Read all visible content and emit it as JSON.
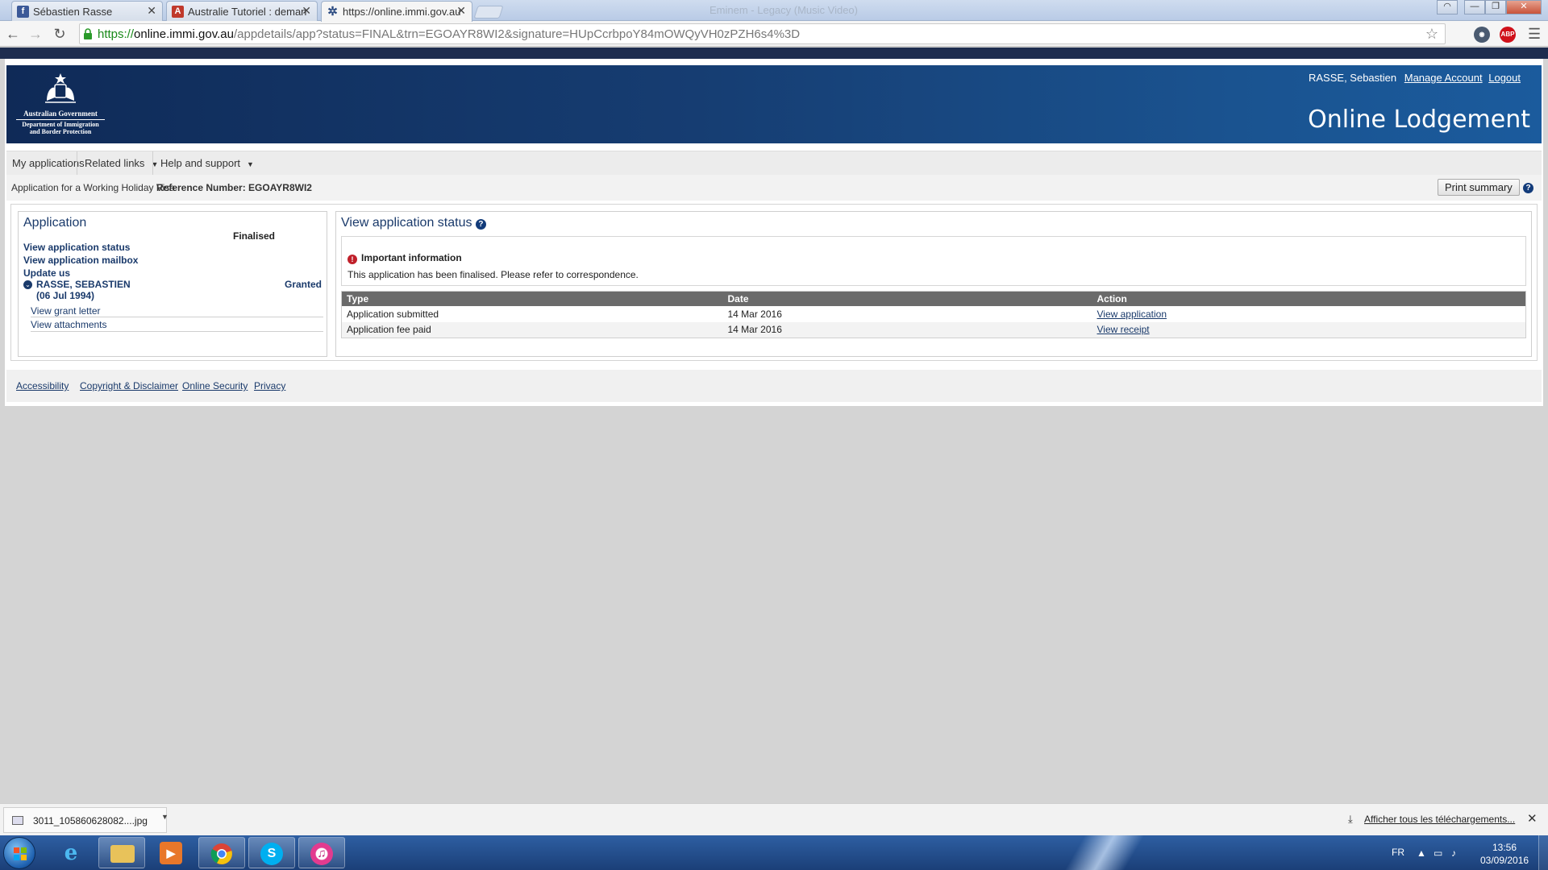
{
  "browser": {
    "tabs": [
      {
        "title": "Sébastien Rasse",
        "icon": "facebook-icon"
      },
      {
        "title": "Australie Tutoriel : deman",
        "icon": "pdf-icon"
      },
      {
        "title": "https://online.immi.gov.au",
        "icon": "loading-gear-icon"
      }
    ],
    "ghost_title": "Eminem - Legacy (Music Video)",
    "url_proto": "https://",
    "url_host": "online.immi.gov.au",
    "url_path": "/appdetails/app?status=FINAL&trn=EGOAYR8WI2&signature=HUpCcrbpoY84mOWQyVH0zPZH6s4%3D",
    "extensions": [
      "eye-extension-icon",
      "adblock-plus-icon"
    ],
    "adblock_label": "ABP"
  },
  "header": {
    "crest_line1": "Australian Government",
    "crest_line2": "Department of Immigration and Border Protection",
    "user_name": "RASSE, Sebastien",
    "manage_account": "Manage Account",
    "logout": "Logout",
    "site_title": "Online Lodgement"
  },
  "menu": {
    "items": [
      {
        "label": "My applications",
        "has_caret": false
      },
      {
        "label": "Related links",
        "has_caret": true
      },
      {
        "label": "Help and support",
        "has_caret": true
      }
    ]
  },
  "crumb": {
    "title": "Application for a Working Holiday Visa",
    "reference": "Reference Number: EGOAYR8WI2",
    "print_label": "Print summary",
    "help_glyph": "?"
  },
  "application": {
    "title": "Application",
    "status": "Finalised",
    "links": [
      "View application status",
      "View application mailbox",
      "Update us"
    ],
    "applicant_name": "RASSE, SEBASTIEN",
    "applicant_dob": "(06 Jul 1994)",
    "applicant_status": "Granted",
    "sub_links": [
      "View grant letter",
      "View attachments"
    ]
  },
  "status_panel": {
    "title": "View application status",
    "info_heading": "Important information",
    "info_text": "This application has been finalised. Please refer to correspondence.",
    "columns": [
      "Type",
      "Date",
      "Action"
    ],
    "rows": [
      {
        "type": "Application submitted",
        "date": "14 Mar 2016",
        "action": "View application"
      },
      {
        "type": "Application fee paid",
        "date": "14 Mar 2016",
        "action": "View receipt"
      }
    ]
  },
  "footer": {
    "links": [
      "Accessibility",
      "Copyright & Disclaimer",
      "Online Security",
      "Privacy"
    ]
  },
  "downloads": {
    "file_name": "3011_105860628082....jpg",
    "show_all": "Afficher tous les téléchargements..."
  },
  "taskbar": {
    "apps": [
      "internet-explorer-icon",
      "file-explorer-icon",
      "media-player-icon",
      "chrome-icon",
      "skype-icon",
      "itunes-icon"
    ],
    "language": "FR",
    "time": "13:56",
    "date": "03/09/2016"
  },
  "colors": {
    "banner_dark": "#0f2a57",
    "banner_light": "#1b5b9d",
    "link": "#1a3a6b",
    "table_header": "#6a6a6a",
    "warning": "#c0202a"
  }
}
